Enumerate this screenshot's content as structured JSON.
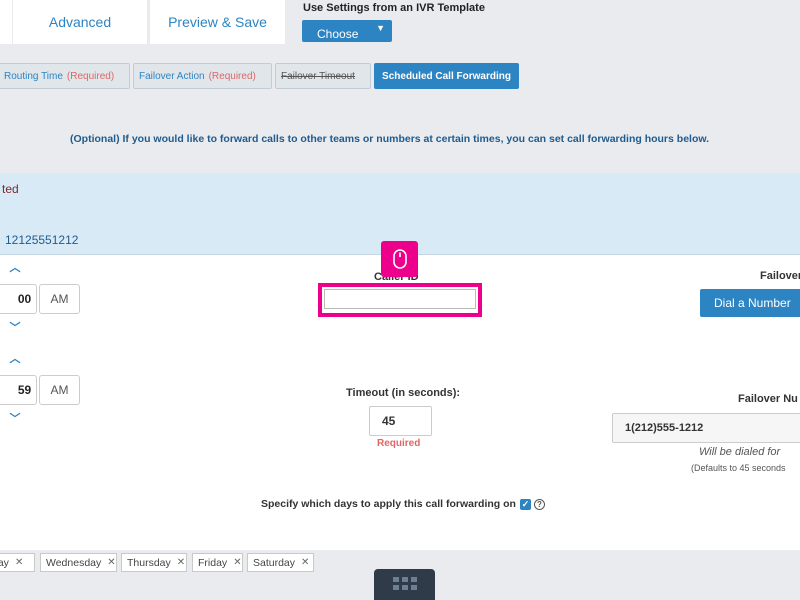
{
  "top_tabs": {
    "advanced": "Advanced",
    "preview_save": "Preview & Save"
  },
  "template": {
    "label": "Use Settings from an IVR Template",
    "select_value": "Choose"
  },
  "sub_tabs": [
    {
      "label": "Routing Time",
      "req": "(Required)"
    },
    {
      "label": "Failover Action",
      "req": "(Required)"
    },
    {
      "label": "Failover Timeout"
    },
    {
      "label": "Scheduled Call Forwarding"
    }
  ],
  "optional_note": "(Optional) If you would like to forward calls to other teams or numbers at certain times, you can set call forwarding hours below.",
  "band": {
    "status": "ted",
    "number": "12125551212"
  },
  "start_time": {
    "minute": "00",
    "ampm": "AM"
  },
  "end_time": {
    "minute": "59",
    "ampm": "AM"
  },
  "caller_id": {
    "label": "Caller ID",
    "value": ""
  },
  "failover_action": {
    "label": "Failover",
    "button": "Dial a Number"
  },
  "timeout": {
    "label": "Timeout (in seconds):",
    "value": "45",
    "required": "Required"
  },
  "failover_number": {
    "label": "Failover Nu",
    "value": "1(212)555-1212",
    "dialed_note": "Will be dialed for",
    "defaults_note": "(Defaults to 45 seconds"
  },
  "specify_days": {
    "label": "Specify which days to apply this call forwarding on",
    "checked": true
  },
  "days": [
    "day",
    "Wednesday",
    "Thursday",
    "Friday",
    "Saturday"
  ],
  "colors": {
    "accent": "#2d84c2",
    "highlight": "#ec008c",
    "required": "#e06666",
    "band": "#d9eaf7"
  },
  "icons": [
    "chevron-up-icon",
    "chevron-down-icon",
    "mouse-icon",
    "checkbox-icon",
    "help-icon",
    "remove-icon",
    "grid-icon"
  ]
}
